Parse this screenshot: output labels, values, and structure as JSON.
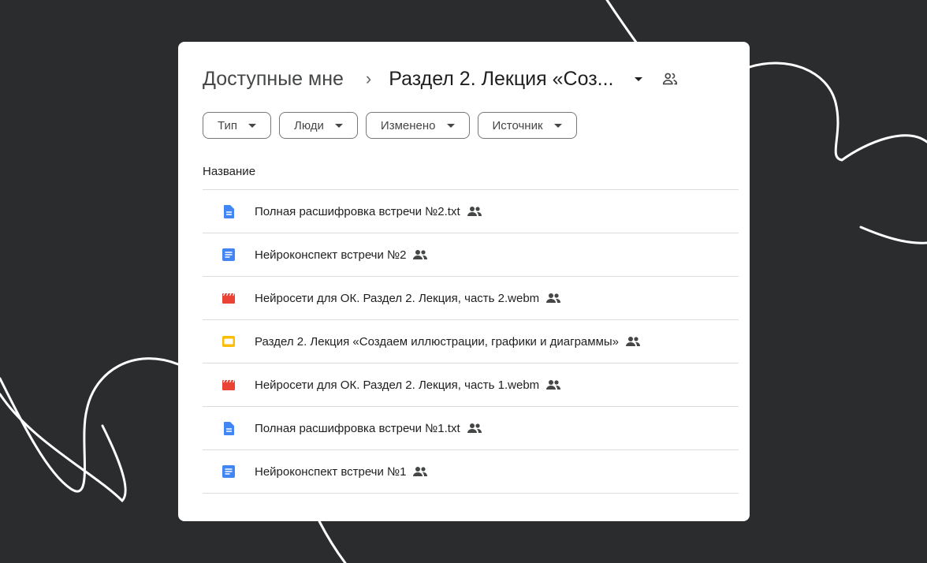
{
  "breadcrumb": {
    "root": "Доступные мне",
    "current": "Раздел 2. Лекция «Соз..."
  },
  "filters": [
    {
      "label": "Тип"
    },
    {
      "label": "Люди"
    },
    {
      "label": "Изменено"
    },
    {
      "label": "Источник"
    }
  ],
  "column_header": "Название",
  "colors": {
    "doc": "#4285f4",
    "video": "#ea4335",
    "slides": "#fbbc04",
    "background": "#2b2c2e"
  },
  "files": [
    {
      "name": "Полная расшифровка встречи №2.txt",
      "type": "text-file-icon"
    },
    {
      "name": "Нейроконспект встречи №2",
      "type": "doc-icon"
    },
    {
      "name": "Нейросети для ОК. Раздел 2. Лекция, часть 2.webm",
      "type": "video-icon"
    },
    {
      "name": "Раздел 2. Лекция «Создаем иллюстрации, графики и диаграммы»",
      "type": "slides-icon"
    },
    {
      "name": "Нейросети для ОК. Раздел 2. Лекция, часть 1.webm",
      "type": "video-icon"
    },
    {
      "name": "Полная расшифровка встречи №1.txt",
      "type": "text-file-icon"
    },
    {
      "name": "Нейроконспект встречи №1",
      "type": "doc-icon"
    }
  ]
}
